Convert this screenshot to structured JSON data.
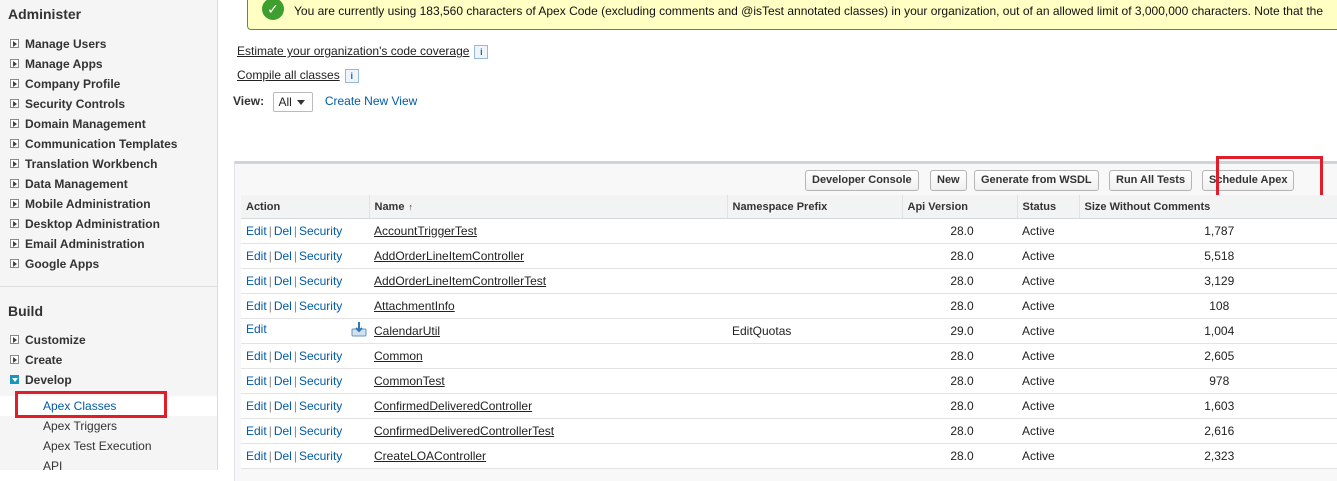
{
  "sidebar": {
    "administer_title": "Administer",
    "administer_items": [
      "Manage Users",
      "Manage Apps",
      "Company Profile",
      "Security Controls",
      "Domain Management",
      "Communication Templates",
      "Translation Workbench",
      "Data Management",
      "Mobile Administration",
      "Desktop Administration",
      "Email Administration",
      "Google Apps"
    ],
    "build_title": "Build",
    "build_items": [
      "Customize",
      "Create",
      "Develop"
    ],
    "develop_subitems": [
      "Apex Classes",
      "Apex Triggers",
      "Apex Test Execution",
      "API"
    ],
    "selected_subitem": "Apex Classes"
  },
  "message": {
    "text": "You are currently using 183,560 characters of Apex Code (excluding comments and @isTest annotated classes) in your organization, out of an allowed limit of 3,000,000 characters. Note that the"
  },
  "links": {
    "estimate": "Estimate your organization's code coverage",
    "compile": "Compile all classes",
    "info_glyph": "i"
  },
  "view": {
    "label": "View:",
    "selected": "All",
    "create_new": "Create New View"
  },
  "buttons": {
    "developer_console": "Developer Console",
    "new": "New",
    "generate_wsdl": "Generate from WSDL",
    "run_all_tests": "Run All Tests",
    "schedule_apex": "Schedule Apex"
  },
  "table": {
    "headers": {
      "action": "Action",
      "name": "Name",
      "name_sort": "↑",
      "namespace": "Namespace Prefix",
      "api": "Api Version",
      "status": "Status",
      "size": "Size Without Comments"
    },
    "action_labels": {
      "edit": "Edit",
      "del": "Del",
      "security": "Security",
      "sep": "|"
    },
    "rows": [
      {
        "name": "AccountTriggerTest",
        "namespace": "",
        "api": "28.0",
        "status": "Active",
        "size": "1,787",
        "managed": false
      },
      {
        "name": "AddOrderLineItemController",
        "namespace": "",
        "api": "28.0",
        "status": "Active",
        "size": "5,518",
        "managed": false
      },
      {
        "name": "AddOrderLineItemControllerTest",
        "namespace": "",
        "api": "28.0",
        "status": "Active",
        "size": "3,129",
        "managed": false
      },
      {
        "name": "AttachmentInfo",
        "namespace": "",
        "api": "28.0",
        "status": "Active",
        "size": "108",
        "managed": false
      },
      {
        "name": "CalendarUtil",
        "namespace": "EditQuotas",
        "api": "29.0",
        "status": "Active",
        "size": "1,004",
        "managed": true
      },
      {
        "name": "Common",
        "namespace": "",
        "api": "28.0",
        "status": "Active",
        "size": "2,605",
        "managed": false
      },
      {
        "name": "CommonTest",
        "namespace": "",
        "api": "28.0",
        "status": "Active",
        "size": "978",
        "managed": false
      },
      {
        "name": "ConfirmedDeliveredController",
        "namespace": "",
        "api": "28.0",
        "status": "Active",
        "size": "1,603",
        "managed": false
      },
      {
        "name": "ConfirmedDeliveredControllerTest",
        "namespace": "",
        "api": "28.0",
        "status": "Active",
        "size": "2,616",
        "managed": false
      },
      {
        "name": "CreateLOAController",
        "namespace": "",
        "api": "28.0",
        "status": "Active",
        "size": "2,323",
        "managed": false
      }
    ]
  },
  "colors": {
    "link_blue": "#015ba7",
    "highlight_red": "#e11d2a",
    "success_green": "#3e9f2e",
    "message_bg": "#ffffc4"
  }
}
